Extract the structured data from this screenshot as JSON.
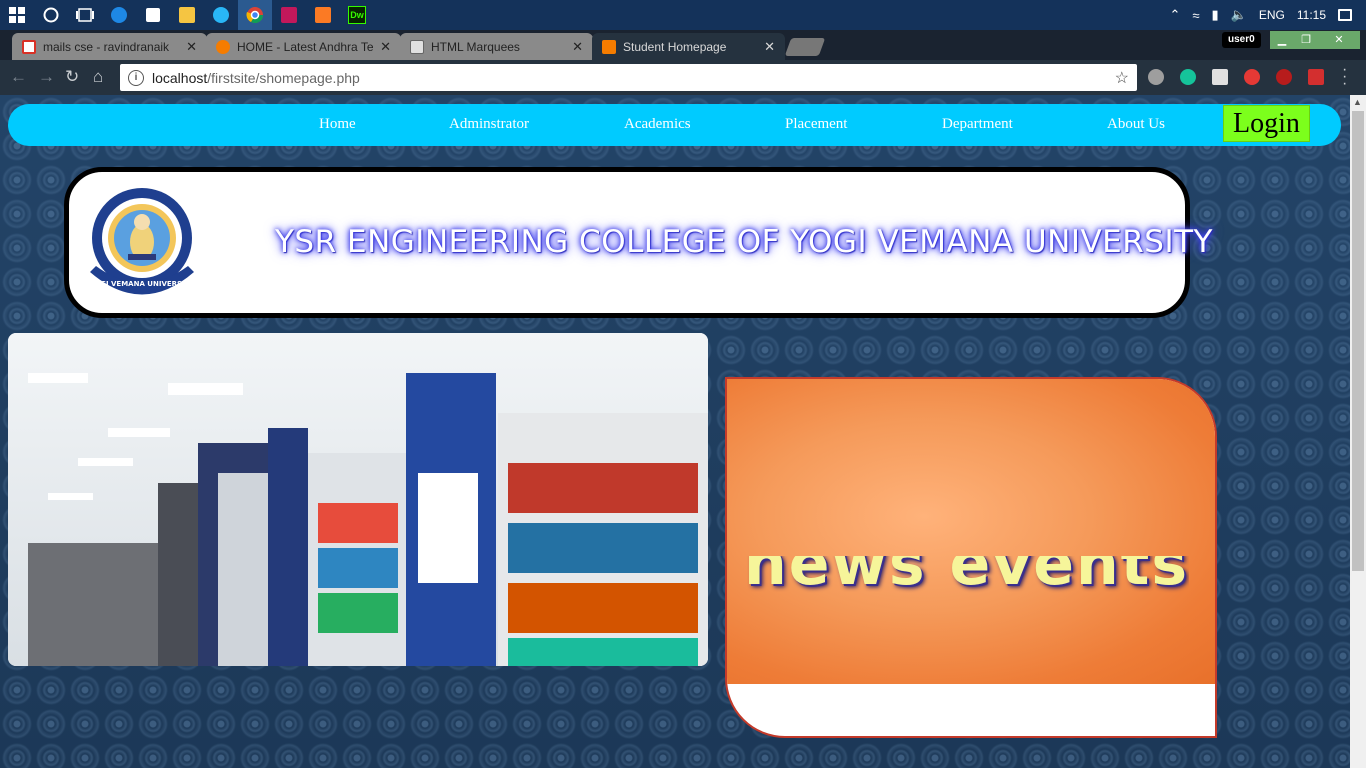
{
  "taskbar": {
    "icons": [
      "windows-start-icon",
      "search-circle-icon",
      "task-view-icon",
      "edge-icon",
      "store-icon",
      "file-explorer-icon",
      "ie-icon",
      "chrome-icon",
      "winrar-icon",
      "xampp-icon",
      "dreamweaver-icon"
    ],
    "dreamweaver_label": "Dw",
    "language": "ENG",
    "time": "11:15"
  },
  "browser": {
    "tabs": [
      {
        "title": "mails cse - ravindranaik",
        "favicon_color": "#d93025"
      },
      {
        "title": "HOME - Latest Andhra Te",
        "favicon_color": "#f57c00"
      },
      {
        "title": "HTML Marquees",
        "favicon_color": "#9e9e9e"
      },
      {
        "title": "Student Homepage",
        "favicon_color": "#f57c00",
        "active": true
      }
    ],
    "profile": "user0",
    "address": {
      "host": "localhost",
      "path": "/firstsite/shomepage.php"
    }
  },
  "site": {
    "nav": [
      {
        "label": "Home"
      },
      {
        "label": "Adminstrator"
      },
      {
        "label": "Academics"
      },
      {
        "label": "Placement"
      },
      {
        "label": "Department"
      },
      {
        "label": "About Us"
      }
    ],
    "login_label": "Login",
    "college_title": "YSR ENGINEERING COLLEGE OF YOGI VEMANA UNIVERSITY",
    "seal_text": "YOGI VEMANA UNIVERSITY",
    "news_text": "news    events",
    "colors": {
      "nav_bar": "#00cbff",
      "login_button": "#7cff1c",
      "news_panel": "#ee7c37"
    }
  }
}
